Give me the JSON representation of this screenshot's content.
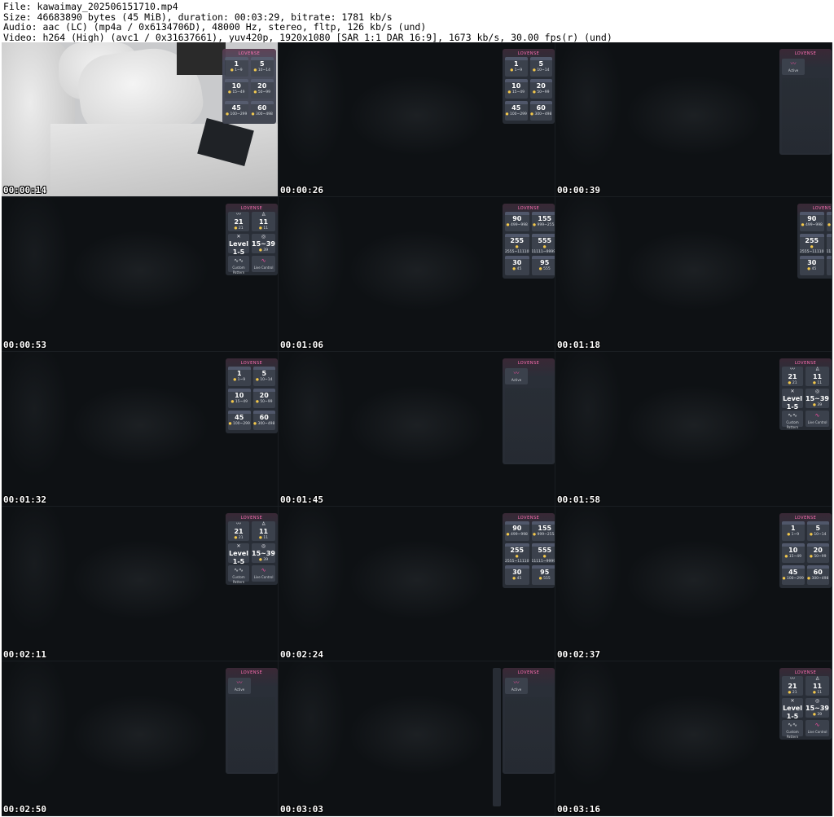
{
  "header": {
    "file_line": "File: kawaimay_202506151710.mp4",
    "size_line": "Size: 46683890 bytes (45 MiB), duration: 00:03:29, bitrate: 1781 kb/s",
    "audio_line": "Audio: aac (LC) (mp4a / 0x6134706D), 48000 Hz, stereo, fltp, 126 kb/s (und)",
    "video_line": "Video: h264 (High) (avc1 / 0x31637661), yuv420p, 1920x1080 [SAR 1:1 DAR 16:9], 1673 kb/s, 30.00 fps(r) (und)"
  },
  "brand": "LOVENSE",
  "panels": {
    "levels_a": [
      {
        "big": "1",
        "small": "1~9"
      },
      {
        "big": "5",
        "small": "10~14"
      },
      {
        "big": "10",
        "small": "15~49"
      },
      {
        "big": "20",
        "small": "50~99"
      },
      {
        "big": "45",
        "small": "100~299"
      },
      {
        "big": "60",
        "small": "300~498"
      }
    ],
    "levels_b": [
      {
        "big": "90",
        "small": "499~998"
      },
      {
        "big": "155",
        "small": "999~2554"
      },
      {
        "big": "255",
        "small": "2555~11110"
      },
      {
        "big": "555",
        "small": "11111~99999"
      },
      {
        "big": "30",
        "small": "45"
      },
      {
        "big": "95",
        "small": "555"
      }
    ],
    "special": [
      {
        "big": "21",
        "small": "21"
      },
      {
        "big": "11",
        "small": "11"
      },
      {
        "big": "Level 1-5",
        "small": "31"
      },
      {
        "big": "15~39",
        "small": "39"
      }
    ],
    "cmd_custom": "Custom Pattern",
    "cmd_live": "Live Control",
    "single_label": "Active"
  },
  "timestamps": [
    "00:00:14",
    "00:00:26",
    "00:00:39",
    "00:00:53",
    "00:01:06",
    "00:01:18",
    "00:01:32",
    "00:01:45",
    "00:01:58",
    "00:02:11",
    "00:02:24",
    "00:02:37",
    "00:02:50",
    "00:03:03",
    "00:03:16"
  ]
}
